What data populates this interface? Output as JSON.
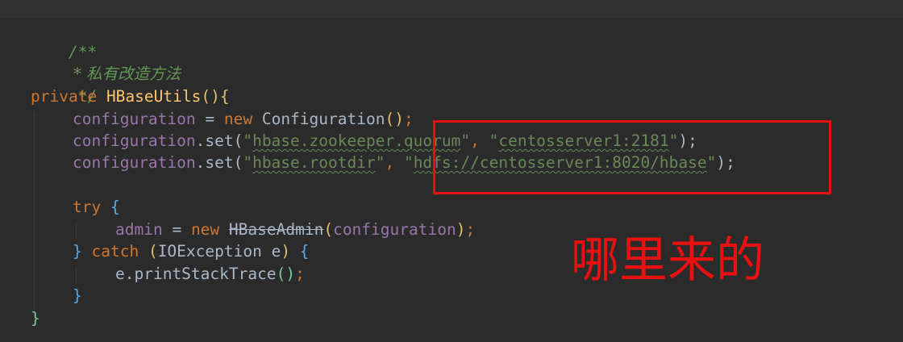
{
  "colors": {
    "background": "#2b2b2b",
    "comment": "#629755",
    "keyword": "#cc7832",
    "method": "#ffc66d",
    "string": "#6a8759",
    "field": "#9876aa",
    "text": "#a9b7c6",
    "annotation": "#e81010"
  },
  "code": {
    "l1": "/**",
    "l2": " * 私有改造方法",
    "l3": " */",
    "l4": {
      "kw": "private",
      "name": "HBaseUtils",
      "open": "()",
      "brace": "{"
    },
    "l5": {
      "field": "configuration",
      "eq": " = ",
      "kw": "new",
      "cls": " Configuration",
      "paren": "()",
      "semi": ";"
    },
    "l6": {
      "field": "configuration",
      "call": ".set(",
      "arg1_q1": "\"",
      "arg1": "hbase.zookeeper.quorum",
      "arg1_q2": "\"",
      "comma": ", ",
      "arg2_q1": "\"",
      "arg2": "centosserver1:2181",
      "arg2_q2": "\"",
      "end": ");"
    },
    "l7": {
      "field": "configuration",
      "call": ".set(",
      "arg1_q1": "\"",
      "arg1": "hbase.rootdir",
      "arg1_q2": "\"",
      "comma": ", ",
      "arg2_q1": "\"",
      "arg2": "hdfs://centosserver1:8020/hbase",
      "arg2_q2": "\"",
      "end": ");"
    },
    "l9": {
      "kw": "try",
      "brace": " {"
    },
    "l10": {
      "field": "admin",
      "eq": " = ",
      "kw": "new",
      "sp": " ",
      "cls": "HBaseAdmin",
      "open": "(",
      "arg": "configuration",
      "close": ")",
      "semi": ";"
    },
    "l11": {
      "close": "}",
      "kw": " catch",
      "open": " (",
      "exc": "IOException e",
      "close_paren": ")",
      "brace": " {"
    },
    "l12": {
      "call": "e.printStackTrace",
      "paren": "()",
      "semi": ";"
    },
    "l13": "}",
    "l14": "}"
  },
  "annotation": {
    "text": "哪里来的"
  }
}
